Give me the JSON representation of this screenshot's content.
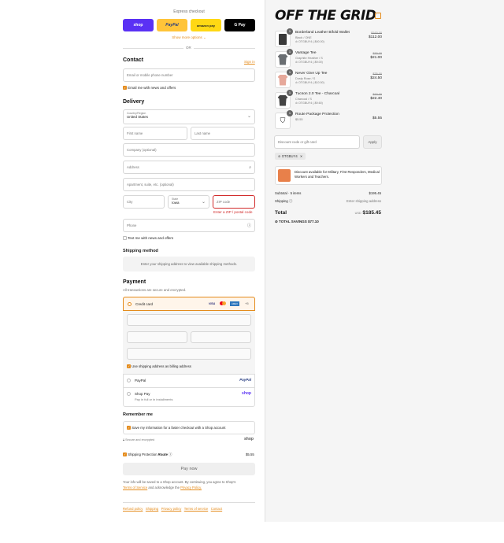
{
  "express": {
    "label": "Express checkout",
    "shop": "shop",
    "paypal": "PayPal",
    "amazon": "amazon pay",
    "gpay": "G Pay",
    "more": "Show more options",
    "or": "OR"
  },
  "contact": {
    "title": "Contact",
    "signin": "Sign in",
    "email_placeholder": "Email or mobile phone number",
    "news": "Email me with news and offers"
  },
  "delivery": {
    "title": "Delivery",
    "country_label": "Country/Region",
    "country": "United States",
    "first": "First name",
    "last": "Last name",
    "company": "Company (optional)",
    "address": "Address",
    "apt": "Apartment, suite, etc. (optional)",
    "city": "City",
    "state_label": "State",
    "state": "Iowa",
    "zip": "ZIP code",
    "zip_error": "Enter a ZIP / postal code",
    "phone": "Phone",
    "text_news": "Text me with news and offers"
  },
  "shipping_method": {
    "title": "Shipping method",
    "note": "Enter your shipping address to view available shipping methods."
  },
  "payment": {
    "title": "Payment",
    "subtitle": "All transactions are secure and encrypted.",
    "credit": "Credit card",
    "card_more": "+5",
    "billing": "Use shipping address as billing address",
    "paypal": "PayPal",
    "shoppay": "Shop Pay",
    "shoppay_sub": "Pay in full or in installments"
  },
  "remember": {
    "title": "Remember me",
    "save": "Save my information for a faster checkout with a Shop account",
    "secure": "Secure and encrypted",
    "shop": "shop"
  },
  "protection": {
    "label": "Shipping Protection",
    "brand": "Route",
    "price": "$5.55"
  },
  "pay_now": "Pay now",
  "legal": {
    "line1": "Your info will be saved to a Shop account. By continuing, you agree to Shop's",
    "terms": "Terms of Service",
    "and": "and acknowledge the",
    "privacy": "Privacy Policy."
  },
  "footer_links": [
    "Refund policy",
    "Shipping",
    "Privacy policy",
    "Terms of service",
    "Contact"
  ],
  "brand": {
    "logo": "OFF THE GRID"
  },
  "products": [
    {
      "qty": "1",
      "name": "Borderland Leather Bifold Wallet",
      "variant": "Black / ONE",
      "discount": "OTGBUY4 (-$40.00)",
      "old": "$160.00",
      "price": "$112.00",
      "color": "#3a3a3a"
    },
    {
      "qty": "1",
      "name": "Vantage Tee",
      "variant": "Graphite Heather / S",
      "discount": "OTGBUY4 (-$9.00)",
      "old": "$30.00",
      "price": "$21.00",
      "color": "#6a6e72"
    },
    {
      "qty": "1",
      "name": "Never Give Up Tee",
      "variant": "Dusty Rose / S",
      "discount": "OTGBUY4 (-$10.50)",
      "old": "$35.00",
      "price": "$24.50",
      "color": "#e6a89a"
    },
    {
      "qty": "1",
      "name": "Tucson 2.0 Tee - Charcoal",
      "variant": "Charcoal / S",
      "discount": "OTGBUY4 (-$9.60)",
      "old": "$32.00",
      "price": "$22.40",
      "color": "#444"
    },
    {
      "qty": "1",
      "name": "Route Package Protection",
      "variant": "$5.55",
      "discount": "",
      "old": "",
      "price": "$5.55",
      "color": "#222"
    }
  ],
  "discount": {
    "placeholder": "Discount code or gift card",
    "apply": "Apply",
    "tag": "OTGBUY4"
  },
  "military": "Discount available for Military, First Responders, Medical Workers and Teachers.",
  "summary": {
    "subtotal_label": "Subtotal · 5 items",
    "subtotal": "$195.45",
    "shipping_label": "Shipping",
    "shipping": "Enter shipping address",
    "total_label": "Total",
    "currency": "USD",
    "total": "$185.45",
    "savings_label": "TOTAL SAVINGS",
    "savings": "$77.10"
  },
  "colors": {
    "accent": "#e48b1b",
    "error": "#d12b2b",
    "shop": "#5a31f4",
    "paypal": "#ffc439"
  }
}
